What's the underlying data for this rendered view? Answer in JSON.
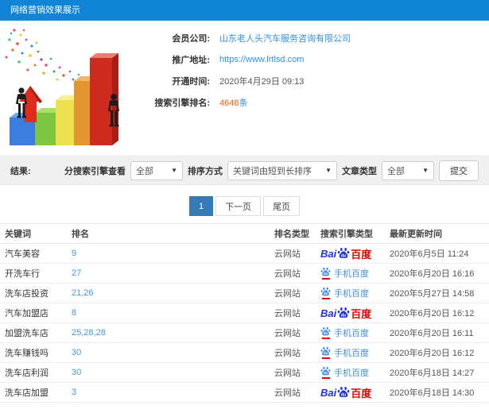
{
  "topbar": {
    "title": "网络营销效果展示"
  },
  "info": {
    "rows": [
      {
        "label": "会员公司:",
        "value": "山东老人头汽车服务咨询有限公司"
      },
      {
        "label": "推广地址:",
        "value": "https://www.lrtlsd.com"
      },
      {
        "label": "开通时间:",
        "value": "2020年4月29日 09:13"
      },
      {
        "label": "搜索引擎排名:",
        "value": "4648",
        "suffix": "条"
      }
    ]
  },
  "filters": {
    "result_label": "结果:",
    "engine_filter_label": "分搜索引擎查看",
    "engine_filter_value": "全部",
    "sort_label": "排序方式",
    "sort_value": "关键词由短到长排序",
    "article_type_label": "文章类型",
    "article_type_value": "全部",
    "submit_label": "提交"
  },
  "pagination": {
    "current": "1",
    "next": "下一页",
    "last": "尾页"
  },
  "table": {
    "headers": [
      "关键词",
      "排名",
      "排名类型",
      "搜索引擎类型",
      "最新更新时间"
    ],
    "engines": {
      "baidu": {
        "bai": "Bai",
        "du": "du",
        "cn": "百度"
      },
      "mobile_baidu": {
        "du": "du",
        "label": "手机百度"
      }
    },
    "rows": [
      {
        "keyword": "汽车美容",
        "rank": "9",
        "rank_type": "云网站",
        "engine": "baidu",
        "updated": "2020年6月5日 11:24"
      },
      {
        "keyword": "开洗车行",
        "rank": "27",
        "rank_type": "云网站",
        "engine": "mobile_baidu",
        "updated": "2020年6月20日 16:16"
      },
      {
        "keyword": "洗车店投资",
        "rank": "21,26",
        "rank_type": "云网站",
        "engine": "mobile_baidu",
        "updated": "2020年5月27日 14:58"
      },
      {
        "keyword": "汽车加盟店",
        "rank": "8",
        "rank_type": "云网站",
        "engine": "baidu",
        "updated": "2020年6月20日 16:12"
      },
      {
        "keyword": "加盟洗车店",
        "rank": "25,28,28",
        "rank_type": "云网站",
        "engine": "mobile_baidu",
        "updated": "2020年6月20日 16:11"
      },
      {
        "keyword": "洗车赚钱吗",
        "rank": "30",
        "rank_type": "云网站",
        "engine": "mobile_baidu",
        "updated": "2020年6月20日 16:12"
      },
      {
        "keyword": "洗车店利润",
        "rank": "30",
        "rank_type": "云网站",
        "engine": "mobile_baidu",
        "updated": "2020年6月18日 14:27"
      },
      {
        "keyword": "洗车店加盟",
        "rank": "3",
        "rank_type": "云网站",
        "engine": "baidu",
        "updated": "2020年6月18日 14:30"
      }
    ]
  },
  "colors": {
    "topbar_blue": "#1185d5",
    "link_blue": "#2e91e0",
    "rank_blue": "#4298e0",
    "highlight_orange": "#ff5a00",
    "pagination_active": "#337ab7",
    "baidu_blue": "#2334dc",
    "baidu_red": "#e10500",
    "mobile_baidu_blue": "#3e8ddd"
  }
}
